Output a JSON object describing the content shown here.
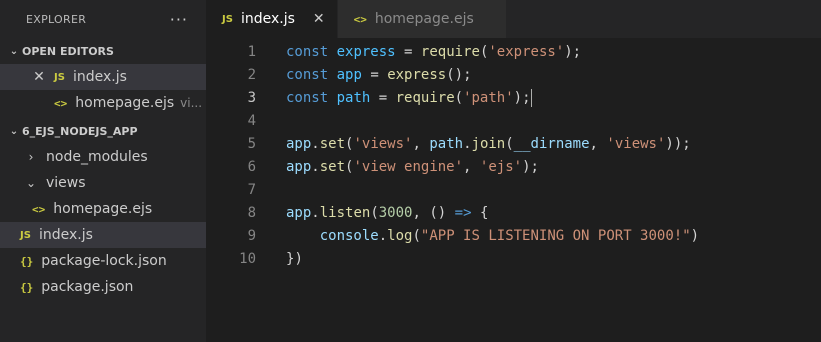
{
  "explorer": {
    "title": "EXPLORER",
    "more": "···",
    "open_editors": {
      "label": "OPEN EDITORS",
      "items": [
        {
          "icon": "JS",
          "name": "index.js",
          "desc": ""
        },
        {
          "icon": "<>",
          "name": "homepage.ejs",
          "desc": "vi..."
        }
      ]
    },
    "project": {
      "label": "6_EJS_NODEJS_APP",
      "items": [
        {
          "type": "folder",
          "name": "node_modules",
          "chevron": "›"
        },
        {
          "type": "folder",
          "name": "views",
          "chevron": "⌄"
        },
        {
          "type": "file",
          "icon": "<>",
          "name": "homepage.ejs"
        },
        {
          "type": "file",
          "icon": "JS",
          "name": "index.js"
        },
        {
          "type": "file",
          "icon": "{}",
          "name": "package-lock.json"
        },
        {
          "type": "file",
          "icon": "{}",
          "name": "package.json"
        }
      ]
    }
  },
  "tabs": [
    {
      "icon": "JS",
      "label": "index.js",
      "close": "✕"
    },
    {
      "icon": "<>",
      "label": "homepage.ejs"
    }
  ],
  "code": {
    "line_numbers": [
      "1",
      "2",
      "3",
      "4",
      "5",
      "6",
      "7",
      "8",
      "9",
      "10"
    ],
    "lines": [
      "const express = require('express');",
      "const app = express();",
      "const path = require('path');",
      "",
      "app.set('views', path.join(__dirname, 'views'));",
      "app.set('view engine', 'ejs');",
      "",
      "app.listen(3000, () => {",
      "    console.log(\"APP IS LISTENING ON PORT 3000!\")",
      "})"
    ]
  },
  "colors": {
    "sidebar_bg": "#252526",
    "editor_bg": "#1e1e1e",
    "keyword": "#569cd6",
    "string": "#ce9178",
    "function": "#dcdcaa",
    "variable": "#4fc1ff",
    "number": "#b5cea8"
  }
}
